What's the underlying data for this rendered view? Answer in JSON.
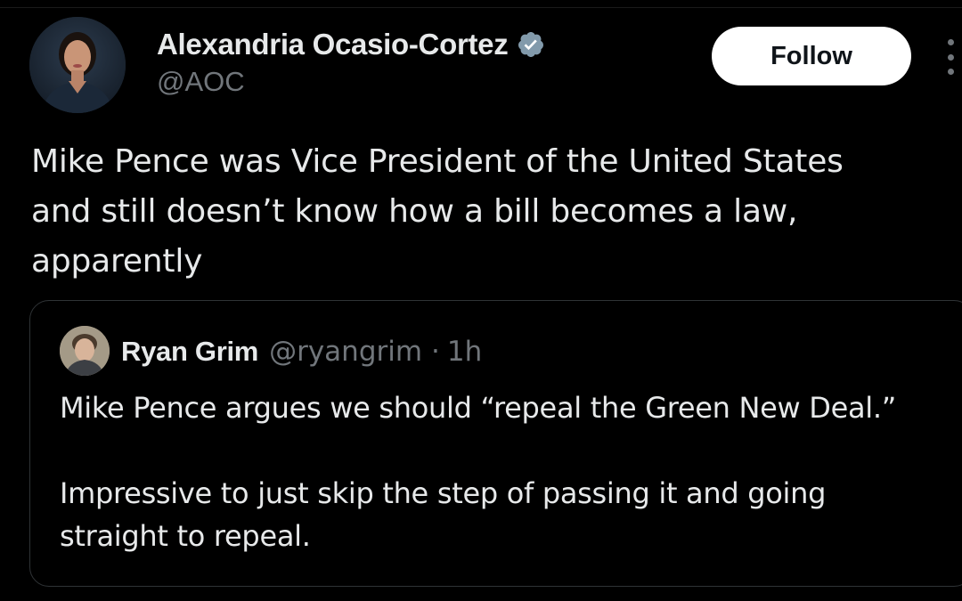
{
  "author": {
    "name": "Alexandria Ocasio-Cortez",
    "handle": "@AOC",
    "verified_color": "#829aab"
  },
  "actions": {
    "follow_label": "Follow"
  },
  "tweet": {
    "lines": [
      "Mike Pence was Vice President of the United States",
      "and still doesn’t know how a bill becomes a law,",
      "apparently"
    ]
  },
  "quote": {
    "name": "Ryan Grim",
    "handle": "@ryangrim",
    "separator": "·",
    "time": "1h",
    "paragraph1": [
      "Mike Pence argues we should “repeal the Green New Deal.”"
    ],
    "paragraph2": [
      "Impressive to just skip the step of passing it and going",
      "straight to repeal."
    ]
  },
  "colors": {
    "background": "#000000",
    "text_primary": "#e7e9ea",
    "text_secondary": "#71767b",
    "border": "#2f3336",
    "follow_bg": "#ffffff"
  }
}
